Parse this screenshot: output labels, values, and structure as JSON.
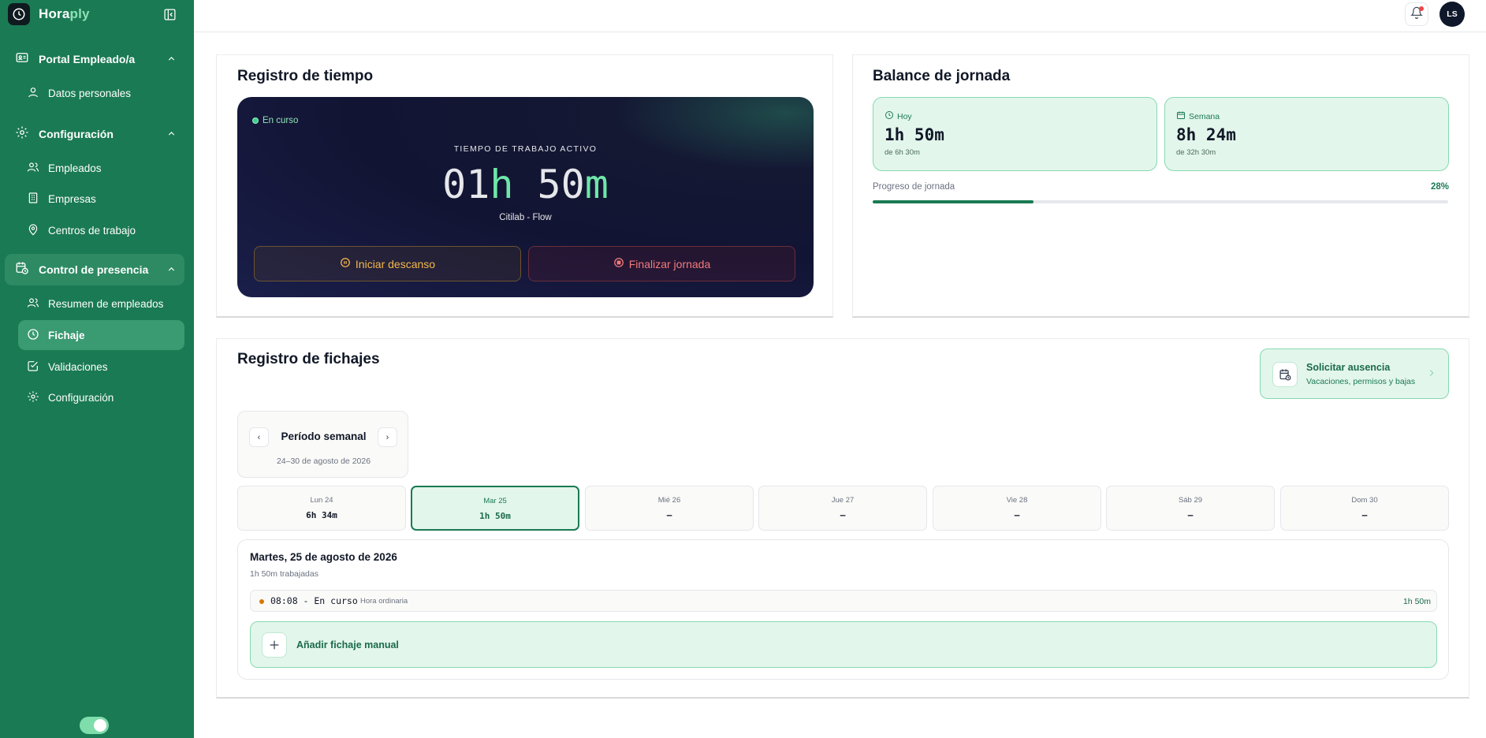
{
  "brand": {
    "name_main": "Hora",
    "name_accent": "ply"
  },
  "sidebar": {
    "groups": [
      {
        "label": "Portal Empleado/a",
        "icon": "id-card-icon",
        "items": [
          {
            "label": "Datos personales",
            "icon": "user-icon"
          }
        ]
      },
      {
        "label": "Configuración",
        "icon": "gear-icon",
        "items": [
          {
            "label": "Empleados",
            "icon": "users-icon"
          },
          {
            "label": "Empresas",
            "icon": "building-icon"
          },
          {
            "label": "Centros de trabajo",
            "icon": "map-pin-icon"
          }
        ]
      },
      {
        "label": "Control de presencia",
        "icon": "calendar-clock-icon",
        "active": true,
        "items": [
          {
            "label": "Resumen de empleados",
            "icon": "users-icon"
          },
          {
            "label": "Fichaje",
            "icon": "clock-icon",
            "active": true
          },
          {
            "label": "Validaciones",
            "icon": "check-square-icon"
          },
          {
            "label": "Configuración",
            "icon": "gear-icon"
          }
        ]
      }
    ],
    "theme_toggle_on": true
  },
  "topbar": {
    "avatar_initials": "LS",
    "has_notification": true
  },
  "registro_tiempo": {
    "title": "Registro de tiempo",
    "status": "En curso",
    "timer_label": "TIEMPO DE TRABAJO ACTIVO",
    "hours": "01",
    "hours_unit": "h",
    "minutes": "50",
    "minutes_unit": "m",
    "location": "Citilab - Flow",
    "pause_button": "Iniciar descanso",
    "stop_button": "Finalizar jornada"
  },
  "balance": {
    "title": "Balance de jornada",
    "today": {
      "label": "Hoy",
      "value": "1h 50m",
      "sub": "de 6h 30m"
    },
    "week": {
      "label": "Semana",
      "value": "8h 24m",
      "sub": "de 32h 30m"
    },
    "progress_label": "Progreso de jornada",
    "progress_text": "28%",
    "progress_fraction": 0.28
  },
  "fichajes": {
    "title": "Registro de fichajes",
    "absence": {
      "title": "Solicitar ausencia",
      "subtitle": "Vacaciones, permisos y bajas"
    },
    "period": {
      "prev": "‹",
      "next": "›",
      "title": "Período semanal",
      "range": "24–30 de agosto de 2026"
    },
    "days": [
      {
        "name": "Lun 24",
        "value": "6h 34m"
      },
      {
        "name": "Mar 25",
        "value": "1h 50m",
        "selected": true
      },
      {
        "name": "Mié 26",
        "value": "–"
      },
      {
        "name": "Jue 27",
        "value": "–"
      },
      {
        "name": "Vie 28",
        "value": "–"
      },
      {
        "name": "Sáb 29",
        "value": "–"
      },
      {
        "name": "Dom 30",
        "value": "–"
      }
    ],
    "detail": {
      "date": "Martes, 25 de agosto de 2026",
      "worked": "1h 50m trabajadas",
      "entry": {
        "time": "08:08 - En curso",
        "type": "Hora ordinaria",
        "duration": "1h 50m"
      },
      "add_manual": "Añadir fichaje manual"
    }
  },
  "colors": {
    "sidebar": "#1a7a53",
    "accent": "#6ee7a8",
    "timer_bg": "#121433"
  }
}
